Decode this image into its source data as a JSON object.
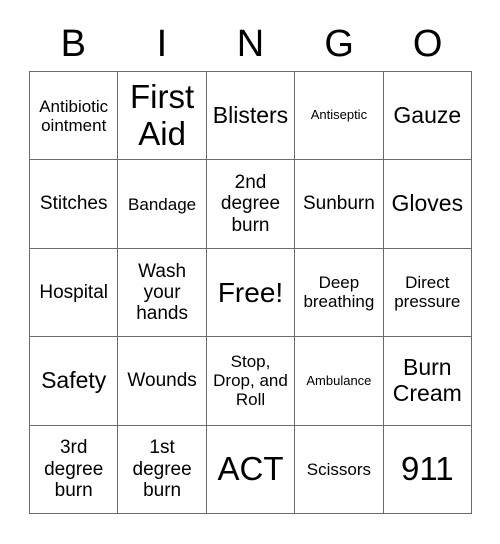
{
  "card": {
    "header": {
      "letters": [
        "B",
        "I",
        "N",
        "G",
        "O"
      ]
    },
    "rows": [
      [
        {
          "text": "Antibiotic ointment",
          "size": "fs-sm"
        },
        {
          "text": "First Aid",
          "size": "fs-xxl"
        },
        {
          "text": "Blisters",
          "size": "fs-lg"
        },
        {
          "text": "Antiseptic",
          "size": "fs-xs"
        },
        {
          "text": "Gauze",
          "size": "fs-lg"
        }
      ],
      [
        {
          "text": "Stitches",
          "size": "fs-md"
        },
        {
          "text": "Bandage",
          "size": "fs-sm"
        },
        {
          "text": "2nd degree burn",
          "size": "fs-md"
        },
        {
          "text": "Sunburn",
          "size": "fs-md"
        },
        {
          "text": "Gloves",
          "size": "fs-lg"
        }
      ],
      [
        {
          "text": "Hospital",
          "size": "fs-md"
        },
        {
          "text": "Wash your hands",
          "size": "fs-md"
        },
        {
          "text": "Free!",
          "size": "fs-xl"
        },
        {
          "text": "Deep breathing",
          "size": "fs-sm"
        },
        {
          "text": "Direct pressure",
          "size": "fs-sm"
        }
      ],
      [
        {
          "text": "Safety",
          "size": "fs-lg"
        },
        {
          "text": "Wounds",
          "size": "fs-md"
        },
        {
          "text": "Stop, Drop, and Roll",
          "size": "fs-sm"
        },
        {
          "text": "Ambulance",
          "size": "fs-xs"
        },
        {
          "text": "Burn Cream",
          "size": "fs-lg"
        }
      ],
      [
        {
          "text": "3rd degree burn",
          "size": "fs-md"
        },
        {
          "text": "1st degree burn",
          "size": "fs-md"
        },
        {
          "text": "ACT",
          "size": "fs-xxl"
        },
        {
          "text": "Scissors",
          "size": "fs-sm"
        },
        {
          "text": "911",
          "size": "fs-xxl"
        }
      ]
    ]
  },
  "colors": {
    "background": "#ffffff",
    "text": "#000000",
    "grid_line": "#6b6b6b"
  }
}
